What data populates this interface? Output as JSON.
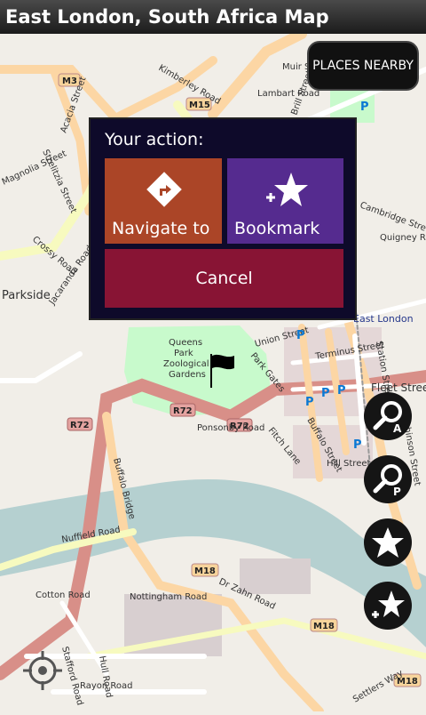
{
  "app": {
    "title": "East London, South Africa Map"
  },
  "places_button": "PLACES NEARBY",
  "dialog": {
    "title": "Your action:",
    "navigate_label": "Navigate to",
    "bookmark_label": "Bookmark",
    "cancel_label": "Cancel",
    "colors": {
      "navigate": "#ab4527",
      "bookmark": "#552b8f",
      "cancel": "#881434",
      "background": "#0e0a2a"
    }
  },
  "side_buttons": {
    "search_address_badge": "A",
    "search_places_badge": "P",
    "bookmarks_icon": "star-icon",
    "add_bookmark_icon": "star-plus-icon"
  },
  "map": {
    "road_badges": [
      "M3",
      "M15",
      "R72",
      "R72",
      "R72",
      "M18",
      "M18",
      "M18"
    ],
    "labels": {
      "parkside": "Parkside",
      "east_london": "East London",
      "park": "Queens Park Zoological Gardens",
      "park_line1": "Queens",
      "park_line2": "Park",
      "park_line3": "Zoological",
      "park_line4": "Gardens"
    },
    "streets": [
      "Kimberley Road",
      "Muir Street",
      "Lambart Road",
      "Brill Street",
      "Cambridge Street",
      "Quigney Road",
      "Jacaranda Road",
      "Crossy Road",
      "Magnolia Street",
      "Acacia Street",
      "Strelitzia Street",
      "Union Street",
      "Terminus Street",
      "Station Street",
      "Fleet Street",
      "Park Gates",
      "Buffalo Street",
      "Hill Street",
      "Fitch Lane",
      "Ponsonby Road",
      "Buffalo Bridge",
      "Nuffield Road",
      "Dr Zahn Road",
      "Cotton Road",
      "Nottingham Road",
      "Stafford Road",
      "Hull Road",
      "Rayon Road",
      "Hutchinson Street",
      "Settlers Way"
    ]
  }
}
